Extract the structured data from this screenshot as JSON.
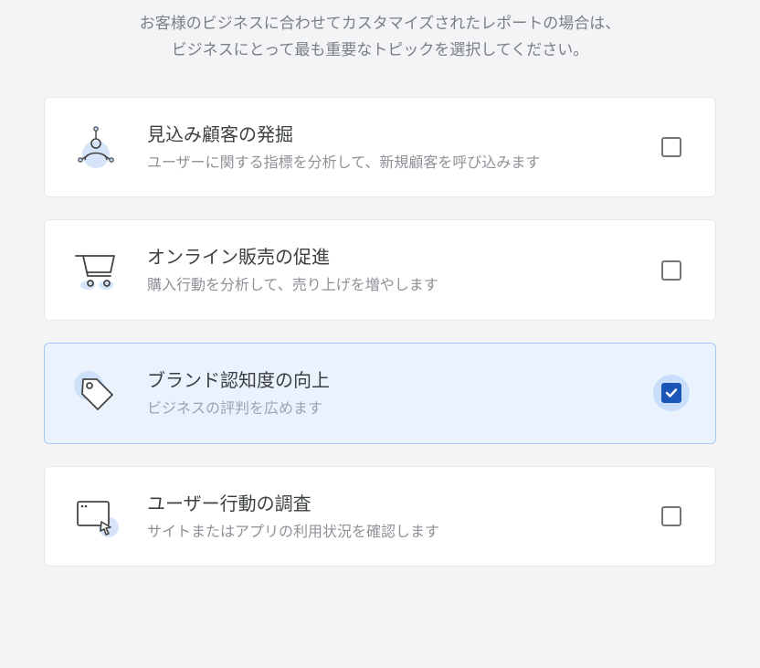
{
  "intro_line1": "お客様のビジネスに合わせてカスタマイズされたレポートの場合は、",
  "intro_line2": "ビジネスにとって最も重要なトピックを選択してください。",
  "cards": [
    {
      "title": "見込み顧客の発掘",
      "desc": "ユーザーに関する指標を分析して、新規顧客を呼び込みます",
      "selected": false
    },
    {
      "title": "オンライン販売の促進",
      "desc": "購入行動を分析して、売り上げを増やします",
      "selected": false
    },
    {
      "title": "ブランド認知度の向上",
      "desc": "ビジネスの評判を広めます",
      "selected": true
    },
    {
      "title": "ユーザー行動の調査",
      "desc": "サイトまたはアプリの利用状況を確認します",
      "selected": false
    }
  ]
}
